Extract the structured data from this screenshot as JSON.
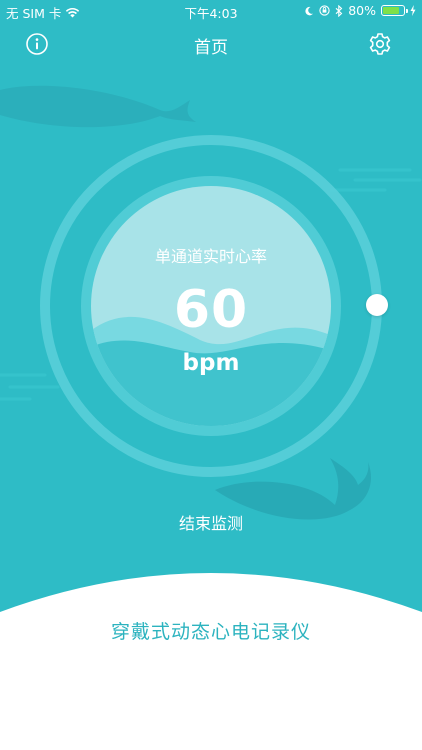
{
  "status_bar": {
    "carrier": "无 SIM 卡",
    "time": "下午4:03",
    "battery_percent": "80%",
    "battery_level": 0.8
  },
  "nav": {
    "title": "首页",
    "info_icon": "info-circle-icon",
    "settings_icon": "gear-icon"
  },
  "monitor": {
    "label": "单通道实时心率",
    "value": "60",
    "unit": "bpm",
    "slider_position": 0.25
  },
  "actions": {
    "stop_label": "结束监测"
  },
  "device": {
    "name": "穿戴式动态心电记录仪"
  },
  "colors": {
    "background": "#2ebcc6",
    "accent_text": "#2cb3bf",
    "battery": "#7ee04a"
  }
}
